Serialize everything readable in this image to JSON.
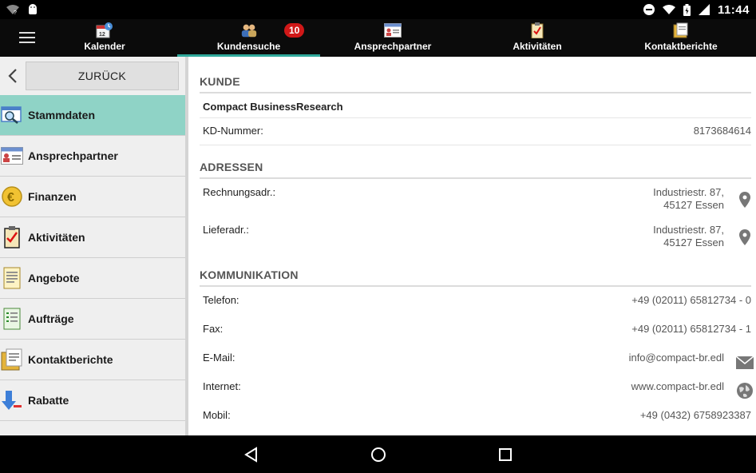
{
  "status": {
    "time": "11:44"
  },
  "tabs": [
    {
      "label": "Kalender",
      "icon": "calendar-icon"
    },
    {
      "label": "Kundensuche",
      "icon": "people-search-icon",
      "badge": "10",
      "active": true
    },
    {
      "label": "Ansprechpartner",
      "icon": "contact-card-icon"
    },
    {
      "label": "Aktivitäten",
      "icon": "clipboard-check-icon"
    },
    {
      "label": "Kontaktberichte",
      "icon": "report-folder-icon"
    }
  ],
  "sidebar": {
    "back_label": "ZURÜCK",
    "items": [
      {
        "label": "Stammdaten",
        "icon": "magnifier-card-icon",
        "active": true
      },
      {
        "label": "Ansprechpartner",
        "icon": "contact-card-icon"
      },
      {
        "label": "Finanzen",
        "icon": "euro-coin-icon"
      },
      {
        "label": "Aktivitäten",
        "icon": "clipboard-check-icon"
      },
      {
        "label": "Angebote",
        "icon": "document-list-icon"
      },
      {
        "label": "Aufträge",
        "icon": "order-list-icon"
      },
      {
        "label": "Kontaktberichte",
        "icon": "report-folder-icon"
      },
      {
        "label": "Rabatte",
        "icon": "down-arrow-discount-icon"
      }
    ]
  },
  "content": {
    "kunde": {
      "heading": "KUNDE",
      "company": "Compact BusinessResearch",
      "kd_label": "KD-Nummer:",
      "kd_value": "8173684614"
    },
    "adressen": {
      "heading": "ADRESSEN",
      "billing_label": "Rechnungsadr.:",
      "billing_line1": "Industriestr. 87,",
      "billing_line2": "45127 Essen",
      "delivery_label": "Lieferadr.:",
      "delivery_line1": "Industriestr. 87,",
      "delivery_line2": "45127 Essen"
    },
    "kommunikation": {
      "heading": "KOMMUNIKATION",
      "phone_label": "Telefon:",
      "phone_value": "+49 (02011) 65812734 - 0",
      "fax_label": "Fax:",
      "fax_value": "+49 (02011) 65812734 - 1",
      "email_label": "E-Mail:",
      "email_value": "info@compact-br.edl",
      "web_label": "Internet:",
      "web_value": "www.compact-br.edl",
      "mobile_label": "Mobil:",
      "mobile_value": "+49 (0432) 6758923387"
    }
  },
  "colors": {
    "accent": "#2fa89a",
    "active_item": "#8fd3c6",
    "badge": "#d01818"
  }
}
